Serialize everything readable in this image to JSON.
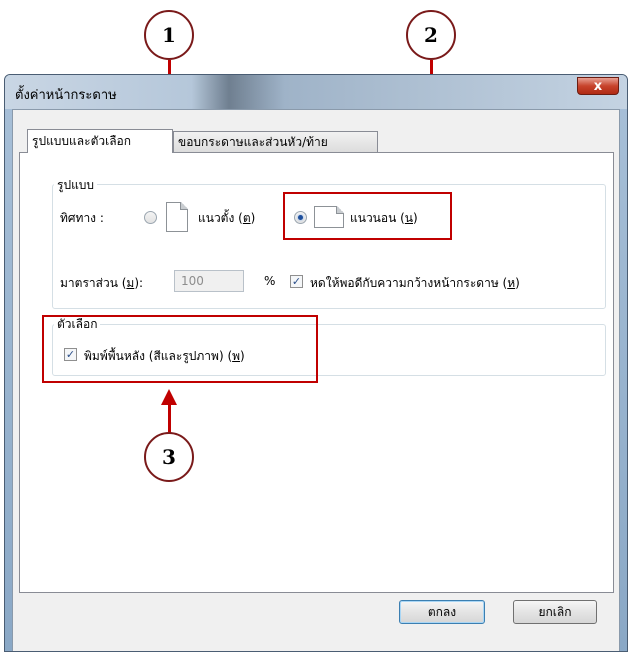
{
  "callouts": [
    "1",
    "2",
    "3"
  ],
  "dialog": {
    "title": "ตั้งค่าหน้ากระดาษ",
    "close_glyph": "x",
    "tabs": [
      {
        "label": "รูปแบบและตัวเลือก",
        "active": true
      },
      {
        "label": "ขอบกระดาษและส่วนหัว/ท้าย",
        "active": false
      }
    ]
  },
  "format_group": {
    "legend": "รูปแบบ",
    "orientation_label": "ทิศทาง :",
    "portrait_label": "แนวตั้ง",
    "portrait_key": "ต",
    "landscape_label": "แนวนอน",
    "landscape_key": "น",
    "selected": "landscape",
    "scale_label": "มาตราส่วน",
    "scale_key": "ม",
    "scale_value": "100",
    "percent": "%",
    "shrink_label": "หดให้พอดีกับความกว้างหน้ากระดาษ",
    "shrink_key": "ห",
    "shrink_checked": true
  },
  "options_group": {
    "legend": "ตัวเลือก",
    "print_bg_label": "พิมพ์พื้นหลัง (สีและรูปภาพ)",
    "print_bg_key": "พ",
    "print_bg_checked": true
  },
  "buttons": {
    "ok": "ตกลง",
    "cancel": "ยกเลิก"
  },
  "colors": {
    "annotation": "#c00000",
    "callout_border": "#7a1a1a",
    "radio_selected": "#1e4f9c"
  }
}
